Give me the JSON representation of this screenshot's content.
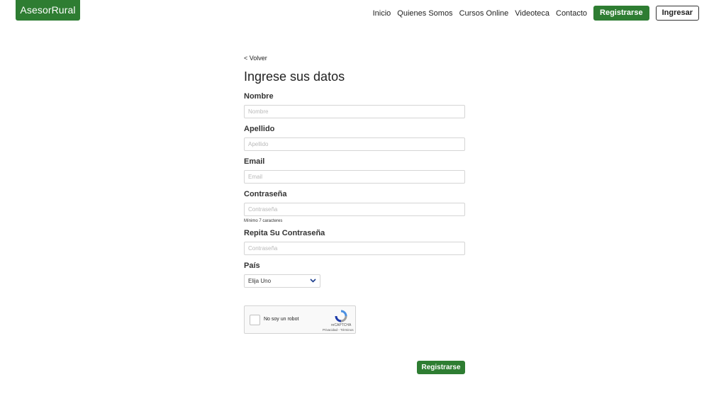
{
  "header": {
    "logo": "AsesorRural",
    "nav": [
      "Inicio",
      "Quienes Somos",
      "Cursos Online",
      "Videoteca",
      "Contacto"
    ],
    "register_button": "Registrarse",
    "login_button": "Ingresar",
    "accent_color": "#2e7d32"
  },
  "form": {
    "back_link": "< Volver",
    "title": "Ingrese sus datos",
    "fields": {
      "nombre": {
        "label": "Nombre",
        "placeholder": "Nombre",
        "value": ""
      },
      "apellido": {
        "label": "Apellido",
        "placeholder": "Apellido",
        "value": ""
      },
      "email": {
        "label": "Email",
        "placeholder": "Email",
        "value": ""
      },
      "password": {
        "label": "Contraseña",
        "placeholder": "Contraseña",
        "hint": "Mínimo 7 caracteres",
        "value": ""
      },
      "repeat_password": {
        "label": "Repita Su Contraseña",
        "placeholder": "Contraseña",
        "value": ""
      },
      "pais": {
        "label": "País",
        "selected": "Elija Uno",
        "icon": "chevron-down-icon"
      }
    },
    "captcha": {
      "label": "No soy un robot",
      "brand": "reCAPTCHA",
      "terms": "Privacidad - Términos",
      "checked": false
    },
    "submit_button": "Registrarse"
  }
}
